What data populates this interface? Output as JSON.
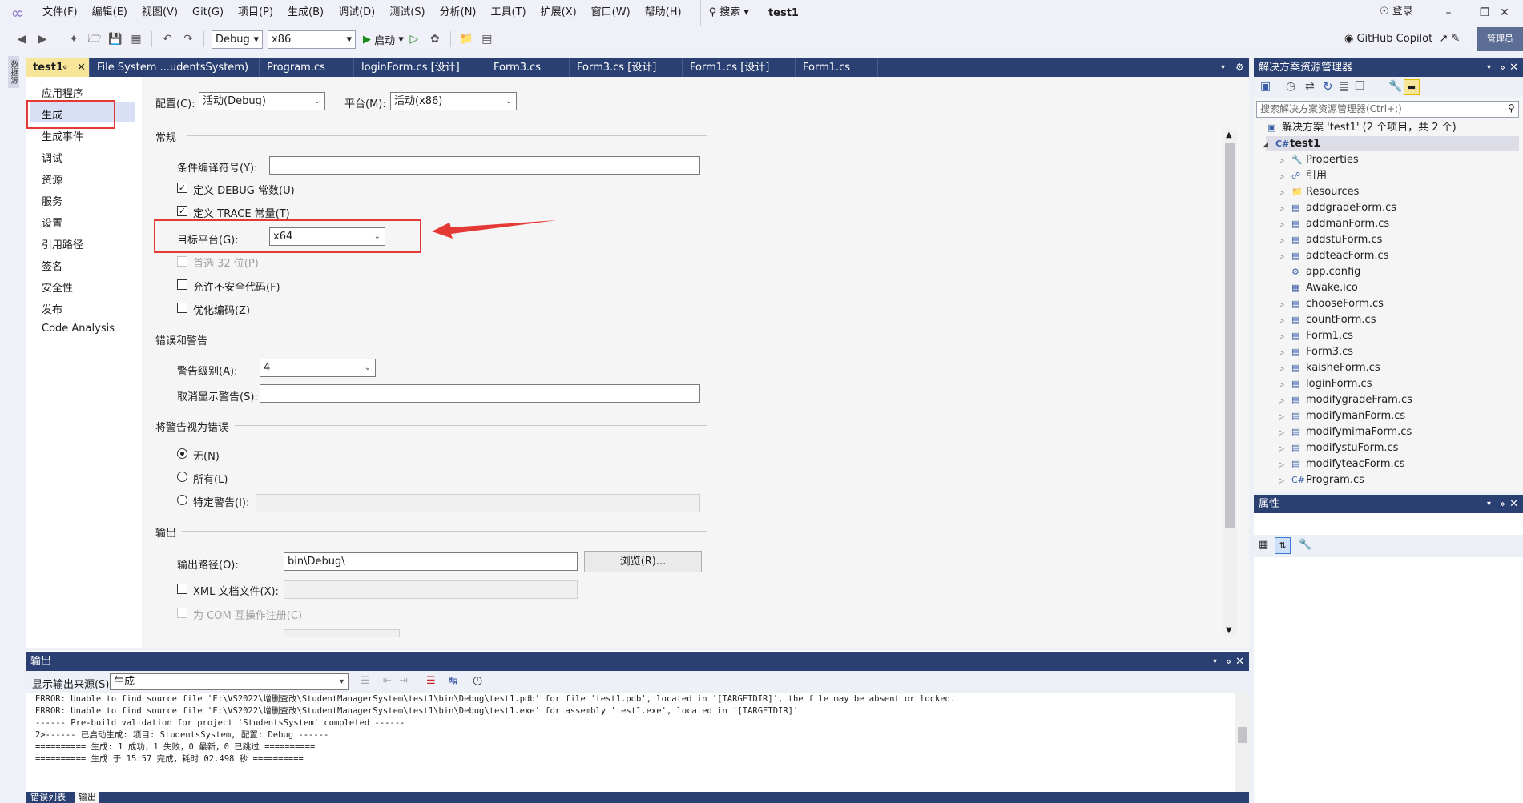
{
  "menu": {
    "items": [
      "文件(F)",
      "编辑(E)",
      "视图(V)",
      "Git(G)",
      "项目(P)",
      "生成(B)",
      "调试(D)",
      "测试(S)",
      "分析(N)",
      "工具(T)",
      "扩展(X)",
      "窗口(W)",
      "帮助(H)"
    ],
    "search": "搜索",
    "solution_name": "test1",
    "signin": "登录"
  },
  "toolbar": {
    "config": "Debug",
    "platform": "x86",
    "start": "启动",
    "copilot": "GitHub Copilot",
    "admin": "管理员"
  },
  "left_strip": {
    "label": "数据源"
  },
  "tabs": [
    "test1",
    "File System ...udentsSystem)",
    "Program.cs",
    "loginForm.cs [设计]",
    "Form3.cs",
    "Form3.cs [设计]",
    "Form1.cs [设计]",
    "Form1.cs"
  ],
  "nav": [
    "应用程序",
    "生成",
    "生成事件",
    "调试",
    "资源",
    "服务",
    "设置",
    "引用路径",
    "签名",
    "安全性",
    "发布",
    "Code Analysis"
  ],
  "build": {
    "config_label": "配置(C):",
    "config_value": "活动(Debug)",
    "platform_label": "平台(M):",
    "platform_value": "活动(x86)",
    "general": "常规",
    "cond_symbols": "条件编译符号(Y):",
    "define_debug": "定义 DEBUG 常数(U)",
    "define_trace": "定义 TRACE 常量(T)",
    "target_platform": "目标平台(G):",
    "target_value": "x64",
    "prefer32": "首选 32 位(P)",
    "unsafe": "允许不安全代码(F)",
    "optimize": "优化编码(Z)",
    "errors_warnings": "错误和警告",
    "warning_level": "警告级别(A):",
    "warning_level_value": "4",
    "suppress": "取消显示警告(S):",
    "treat_as_errors": "将警告视为错误",
    "none": "无(N)",
    "all": "所有(L)",
    "specific": "特定警告(I):",
    "output": "输出",
    "output_path": "输出路径(O):",
    "output_path_value": "bin\\Debug\\",
    "browse": "浏览(R)...",
    "xml_doc": "XML 文档文件(X):",
    "com_interop": "为 COM 互操作注册(C)"
  },
  "solution_explorer": {
    "title": "解决方案资源管理器",
    "search_placeholder": "搜索解决方案资源管理器(Ctrl+;)",
    "root": "解决方案 'test1' (2 个项目，共 2 个)",
    "project": "test1",
    "items": [
      "Properties",
      "引用",
      "Resources",
      "addgradeForm.cs",
      "addmanForm.cs",
      "addstuForm.cs",
      "addteacForm.cs",
      "app.config",
      "Awake.ico",
      "chooseForm.cs",
      "countForm.cs",
      "Form1.cs",
      "Form3.cs",
      "kaisheForm.cs",
      "loginForm.cs",
      "modifygradeFram.cs",
      "modifymanForm.cs",
      "modifymimaForm.cs",
      "modifystuForm.cs",
      "modifyteacForm.cs",
      "Program.cs"
    ]
  },
  "properties": {
    "title": "属性"
  },
  "output": {
    "title": "输出",
    "source_label": "显示输出来源(S):",
    "source_value": "生成",
    "lines": [
      "ERROR: Unable to find source file 'F:\\VS2022\\增删查改\\StudentManagerSystem\\test1\\bin\\Debug\\test1.pdb' for file 'test1.pdb', located in '[TARGETDIR]', the file may be absent or locked.",
      "ERROR: Unable to find source file 'F:\\VS2022\\增删查改\\StudentManagerSystem\\test1\\bin\\Debug\\test1.exe' for assembly 'test1.exe', located in '[TARGETDIR]'",
      "------ Pre-build validation for project 'StudentsSystem' completed ------",
      "2>------ 已启动生成: 项目: StudentsSystem, 配置: Debug ------",
      "========== 生成: 1 成功，1 失败，0 最新，0 已跳过 ==========",
      "========== 生成 于 15:57 完成，耗时 02.498 秒 =========="
    ],
    "tabs": [
      "错误列表",
      "输出"
    ]
  }
}
